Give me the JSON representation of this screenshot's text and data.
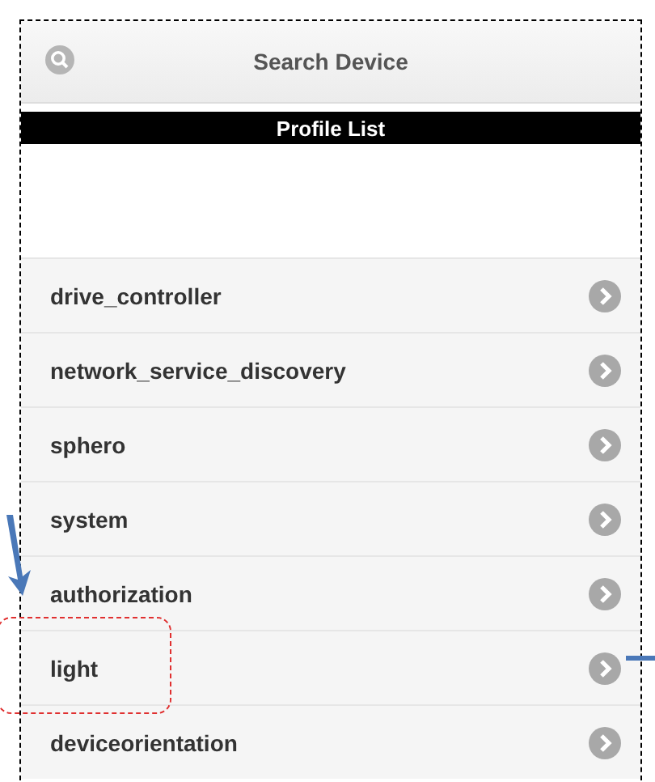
{
  "header": {
    "title": "Search Device"
  },
  "section_bar": {
    "title": "Profile List"
  },
  "profiles": [
    {
      "name": "drive_controller"
    },
    {
      "name": "network_service_discovery"
    },
    {
      "name": "sphero"
    },
    {
      "name": "system"
    },
    {
      "name": "authorization"
    },
    {
      "name": "light"
    },
    {
      "name": "deviceorientation"
    }
  ]
}
